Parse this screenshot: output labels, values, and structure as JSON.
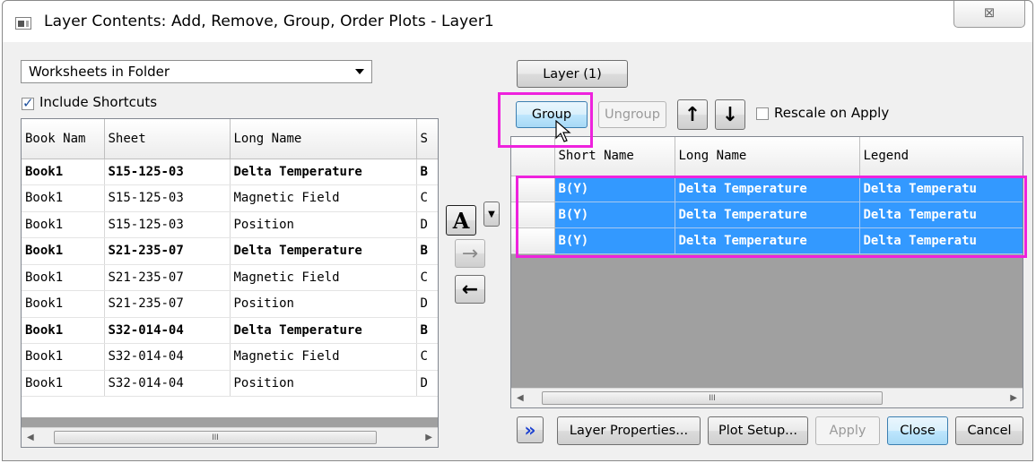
{
  "window": {
    "title": "Layer Contents: Add, Remove, Group, Order Plots - Layer1",
    "close_glyph": "⊠"
  },
  "left": {
    "source_combo": "Worksheets in Folder",
    "include_shortcuts_label": "Include Shortcuts",
    "include_shortcuts_checked": true,
    "columns": [
      "Book Nam",
      "Sheet",
      "Long Name",
      "S"
    ],
    "rows": [
      {
        "book": "Book1",
        "sheet": "S15-125-03",
        "long_name": "Delta Temperature",
        "s": "B",
        "bold": true
      },
      {
        "book": "Book1",
        "sheet": "S15-125-03",
        "long_name": "Magnetic Field",
        "s": "C",
        "bold": false
      },
      {
        "book": "Book1",
        "sheet": "S15-125-03",
        "long_name": "Position",
        "s": "D",
        "bold": false
      },
      {
        "book": "Book1",
        "sheet": "S21-235-07",
        "long_name": "Delta Temperature",
        "s": "B",
        "bold": true
      },
      {
        "book": "Book1",
        "sheet": "S21-235-07",
        "long_name": "Magnetic Field",
        "s": "C",
        "bold": false
      },
      {
        "book": "Book1",
        "sheet": "S21-235-07",
        "long_name": "Position",
        "s": "D",
        "bold": false
      },
      {
        "book": "Book1",
        "sheet": "S32-014-04",
        "long_name": "Delta Temperature",
        "s": "B",
        "bold": true
      },
      {
        "book": "Book1",
        "sheet": "S32-014-04",
        "long_name": "Magnetic Field",
        "s": "C",
        "bold": false
      },
      {
        "book": "Book1",
        "sheet": "S32-014-04",
        "long_name": "Position",
        "s": "D",
        "bold": false
      }
    ],
    "scroll_thumb": "III"
  },
  "middle": {
    "font_button": "A",
    "add_arrow": "→",
    "remove_arrow": "←"
  },
  "right": {
    "layer_button": "Layer (1)",
    "group_button": "Group",
    "ungroup_button": "Ungroup",
    "up_arrow": "↑",
    "down_arrow": "↓",
    "rescale_label": "Rescale on Apply",
    "rescale_checked": false,
    "columns": [
      "Short Name",
      "Long Name",
      "Legend"
    ],
    "rows": [
      {
        "short_name": "B(Y)",
        "long_name": "Delta Temperature",
        "legend": "Delta Temperatu"
      },
      {
        "short_name": "B(Y)",
        "long_name": "Delta Temperature",
        "legend": "Delta Temperatu"
      },
      {
        "short_name": "B(Y)",
        "long_name": "Delta Temperature",
        "legend": "Delta Temperatu"
      }
    ],
    "scroll_thumb": "III"
  },
  "bottom": {
    "expand_glyph": "»",
    "layer_properties": "Layer Properties...",
    "plot_setup": "Plot Setup...",
    "apply": "Apply",
    "close": "Close",
    "cancel": "Cancel"
  },
  "colors": {
    "selection": "#3399ff",
    "highlight": "#ee22dd",
    "grid_background": "#a0a0a0"
  }
}
